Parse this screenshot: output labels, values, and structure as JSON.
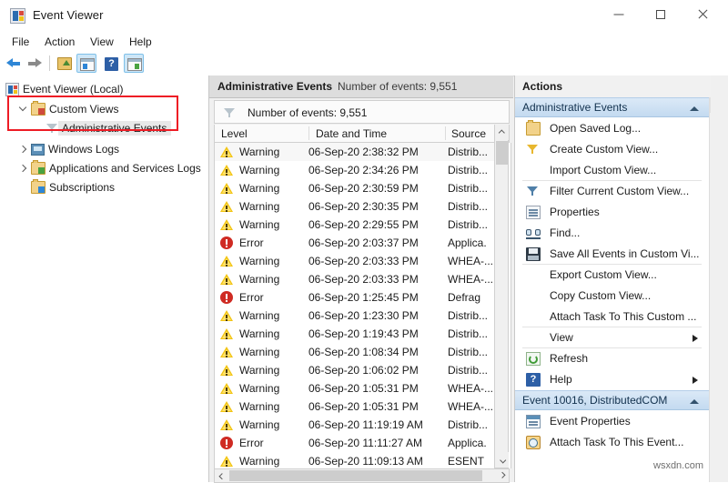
{
  "window": {
    "title": "Event Viewer",
    "icon": "event-viewer-icon",
    "controls": {
      "minimize": "—",
      "maximize": "□",
      "close": "✕"
    }
  },
  "menubar": {
    "items": [
      "File",
      "Action",
      "View",
      "Help"
    ]
  },
  "toolbar": {
    "items": [
      {
        "name": "back-button",
        "icon": "back-arrow-icon",
        "selected": false
      },
      {
        "name": "forward-button",
        "icon": "forward-arrow-icon",
        "selected": false
      },
      {
        "name": "up-one-level-button",
        "icon": "folder-up-icon",
        "selected": false
      },
      {
        "name": "show-hide-console-tree-button",
        "icon": "console-tree-pane-icon",
        "selected": true
      },
      {
        "name": "help-button",
        "icon": "question-mark-icon",
        "selected": false
      },
      {
        "name": "show-hide-action-pane-button",
        "icon": "action-pane-icon",
        "selected": true
      }
    ]
  },
  "tree": {
    "root": {
      "label": "Event Viewer (Local)",
      "icon": "event-viewer-icon"
    },
    "items": [
      {
        "label": "Custom Views",
        "icon": "folder-icon",
        "expander": "down",
        "indent": 1,
        "selected": false
      },
      {
        "label": "Administrative Events",
        "icon": "funnel-icon",
        "expander": "none",
        "indent": 2,
        "selected": true
      },
      {
        "label": "Windows Logs",
        "icon": "monitor-folder-icon",
        "expander": "right",
        "indent": 1,
        "selected": false
      },
      {
        "label": "Applications and Services Logs",
        "icon": "folder-icon",
        "expander": "right",
        "indent": 1,
        "selected": false
      },
      {
        "label": "Subscriptions",
        "icon": "subscriptions-folder-icon",
        "expander": "none",
        "indent": 1,
        "selected": false
      }
    ],
    "highlight_color": "#ee1c25"
  },
  "list": {
    "header_title": "Administrative Events",
    "header_count": "Number of events: 9,551",
    "filter_label": "Number of events: 9,551",
    "filter_icon": "funnel-icon",
    "columns": [
      "Level",
      "Date and Time",
      "Source"
    ],
    "rows": [
      {
        "level": "Warning",
        "severity": "warning",
        "datetime": "06-Sep-20 2:38:32 PM",
        "source": "Distrib..."
      },
      {
        "level": "Warning",
        "severity": "warning",
        "datetime": "06-Sep-20 2:34:26 PM",
        "source": "Distrib..."
      },
      {
        "level": "Warning",
        "severity": "warning",
        "datetime": "06-Sep-20 2:30:59 PM",
        "source": "Distrib..."
      },
      {
        "level": "Warning",
        "severity": "warning",
        "datetime": "06-Sep-20 2:30:35 PM",
        "source": "Distrib..."
      },
      {
        "level": "Warning",
        "severity": "warning",
        "datetime": "06-Sep-20 2:29:55 PM",
        "source": "Distrib..."
      },
      {
        "level": "Error",
        "severity": "error",
        "datetime": "06-Sep-20 2:03:37 PM",
        "source": "Applica."
      },
      {
        "level": "Warning",
        "severity": "warning",
        "datetime": "06-Sep-20 2:03:33 PM",
        "source": "WHEA-..."
      },
      {
        "level": "Warning",
        "severity": "warning",
        "datetime": "06-Sep-20 2:03:33 PM",
        "source": "WHEA-..."
      },
      {
        "level": "Error",
        "severity": "error",
        "datetime": "06-Sep-20 1:25:45 PM",
        "source": "Defrag"
      },
      {
        "level": "Warning",
        "severity": "warning",
        "datetime": "06-Sep-20 1:23:30 PM",
        "source": "Distrib..."
      },
      {
        "level": "Warning",
        "severity": "warning",
        "datetime": "06-Sep-20 1:19:43 PM",
        "source": "Distrib..."
      },
      {
        "level": "Warning",
        "severity": "warning",
        "datetime": "06-Sep-20 1:08:34 PM",
        "source": "Distrib..."
      },
      {
        "level": "Warning",
        "severity": "warning",
        "datetime": "06-Sep-20 1:06:02 PM",
        "source": "Distrib..."
      },
      {
        "level": "Warning",
        "severity": "warning",
        "datetime": "06-Sep-20 1:05:31 PM",
        "source": "WHEA-..."
      },
      {
        "level": "Warning",
        "severity": "warning",
        "datetime": "06-Sep-20 1:05:31 PM",
        "source": "WHEA-..."
      },
      {
        "level": "Warning",
        "severity": "warning",
        "datetime": "06-Sep-20 11:19:19 AM",
        "source": "Distrib..."
      },
      {
        "level": "Error",
        "severity": "error",
        "datetime": "06-Sep-20 11:11:27 AM",
        "source": "Applica."
      },
      {
        "level": "Warning",
        "severity": "warning",
        "datetime": "06-Sep-20 11:09:13 AM",
        "source": "ESENT"
      }
    ]
  },
  "actions": {
    "title": "Actions",
    "sections": [
      {
        "label": "Administrative Events",
        "collapse_icon": "caret-up-icon",
        "items": [
          {
            "label": "Open Saved Log...",
            "icon": "open-folder-icon",
            "submenu": false,
            "sep_after": false
          },
          {
            "label": "Create Custom View...",
            "icon": "funnel-gold-icon",
            "submenu": false,
            "sep_after": false
          },
          {
            "label": "Import Custom View...",
            "icon": "none",
            "submenu": false,
            "sep_after": true
          },
          {
            "label": "Filter Current Custom View...",
            "icon": "funnel-blue-icon",
            "submenu": false,
            "sep_after": false
          },
          {
            "label": "Properties",
            "icon": "properties-icon",
            "submenu": false,
            "sep_after": false
          },
          {
            "label": "Find...",
            "icon": "binoculars-icon",
            "submenu": false,
            "sep_after": false
          },
          {
            "label": "Save All Events in Custom Vi...",
            "icon": "save-icon",
            "submenu": false,
            "sep_after": true
          },
          {
            "label": "Export Custom View...",
            "icon": "none",
            "submenu": false,
            "sep_after": false
          },
          {
            "label": "Copy Custom View...",
            "icon": "none",
            "submenu": false,
            "sep_after": false
          },
          {
            "label": "Attach Task To This Custom ...",
            "icon": "none",
            "submenu": false,
            "sep_after": true
          },
          {
            "label": "View",
            "icon": "none",
            "submenu": true,
            "sep_after": true
          },
          {
            "label": "Refresh",
            "icon": "refresh-icon",
            "submenu": false,
            "sep_after": false
          },
          {
            "label": "Help",
            "icon": "question-mark-icon",
            "submenu": true,
            "sep_after": false
          }
        ]
      },
      {
        "label": "Event 10016, DistributedCOM",
        "collapse_icon": "caret-up-icon",
        "items": [
          {
            "label": "Event Properties",
            "icon": "event-properties-icon",
            "submenu": false,
            "sep_after": false
          },
          {
            "label": "Attach Task To This Event...",
            "icon": "clock-task-icon",
            "submenu": false,
            "sep_after": false
          }
        ]
      }
    ]
  },
  "watermark": {
    "text": "wsxdn.com"
  }
}
